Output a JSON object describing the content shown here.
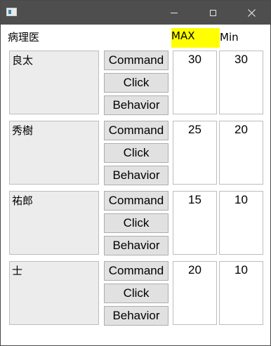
{
  "window": {
    "controls": {
      "minimize": "minimize",
      "maximize": "maximize",
      "close": "close"
    }
  },
  "header": {
    "title": "病理医",
    "max_label": "MAX",
    "min_label": "Min",
    "max_highlight_color": "#ffff00"
  },
  "rows": [
    {
      "name": "良太",
      "buttons": [
        "Command",
        "Click",
        "Behavior"
      ],
      "max": "30",
      "min": "30"
    },
    {
      "name": "秀樹",
      "buttons": [
        "Command",
        "Click",
        "Behavior"
      ],
      "max": "25",
      "min": "20"
    },
    {
      "name": "祐郎",
      "buttons": [
        "Command",
        "Click",
        "Behavior"
      ],
      "max": "15",
      "min": "10"
    },
    {
      "name": "士",
      "buttons": [
        "Command",
        "Click",
        "Behavior"
      ],
      "max": "20",
      "min": "10"
    }
  ]
}
